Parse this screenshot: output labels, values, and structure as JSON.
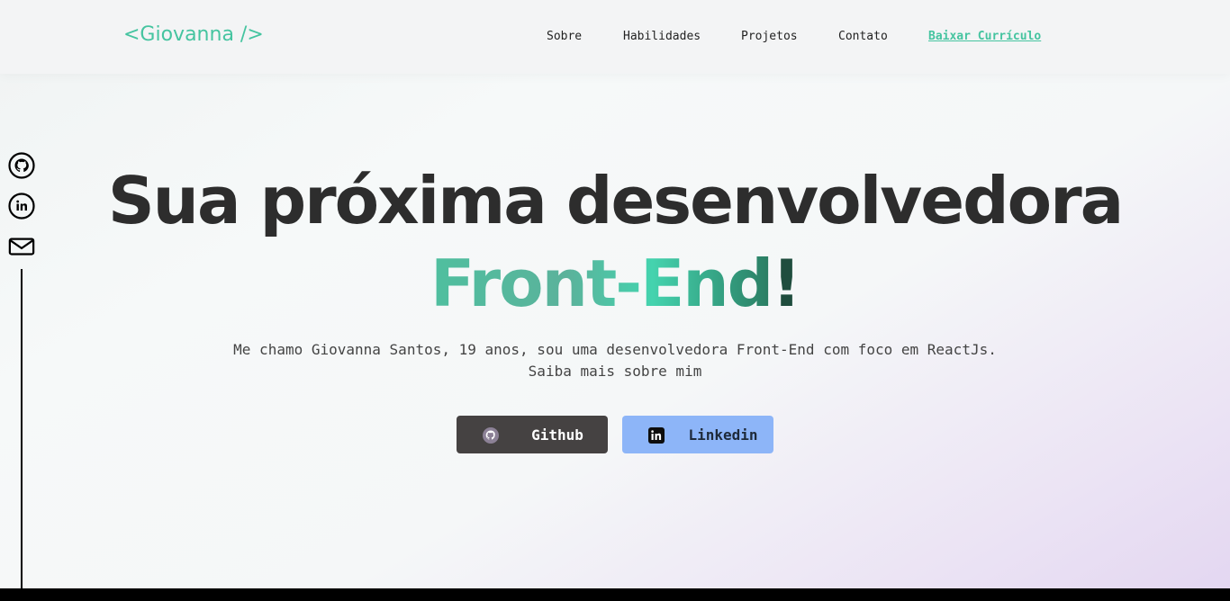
{
  "header": {
    "logo": "<Giovanna />",
    "nav": [
      "Sobre",
      "Habilidades",
      "Projetos",
      "Contato"
    ],
    "resume_link": "Baixar Currículo"
  },
  "social": {
    "icons": [
      "github-icon",
      "linkedin-icon",
      "mail-icon"
    ]
  },
  "hero": {
    "headline_line1": "Sua próxima desenvolvedora",
    "headline_accent": "Front-End",
    "headline_excl": "!",
    "subtitle_line1": "Me chamo Giovanna Santos, 19 anos, sou uma desenvolvedora Front-End com foco em ReactJs.",
    "subtitle_line2": "Saiba mais sobre mim",
    "buttons": {
      "github": "Github",
      "linkedin": "Linkedin"
    }
  },
  "colors": {
    "accent": "#45c4a0",
    "github_button": "#454242",
    "linkedin_button": "#8db5f8"
  }
}
